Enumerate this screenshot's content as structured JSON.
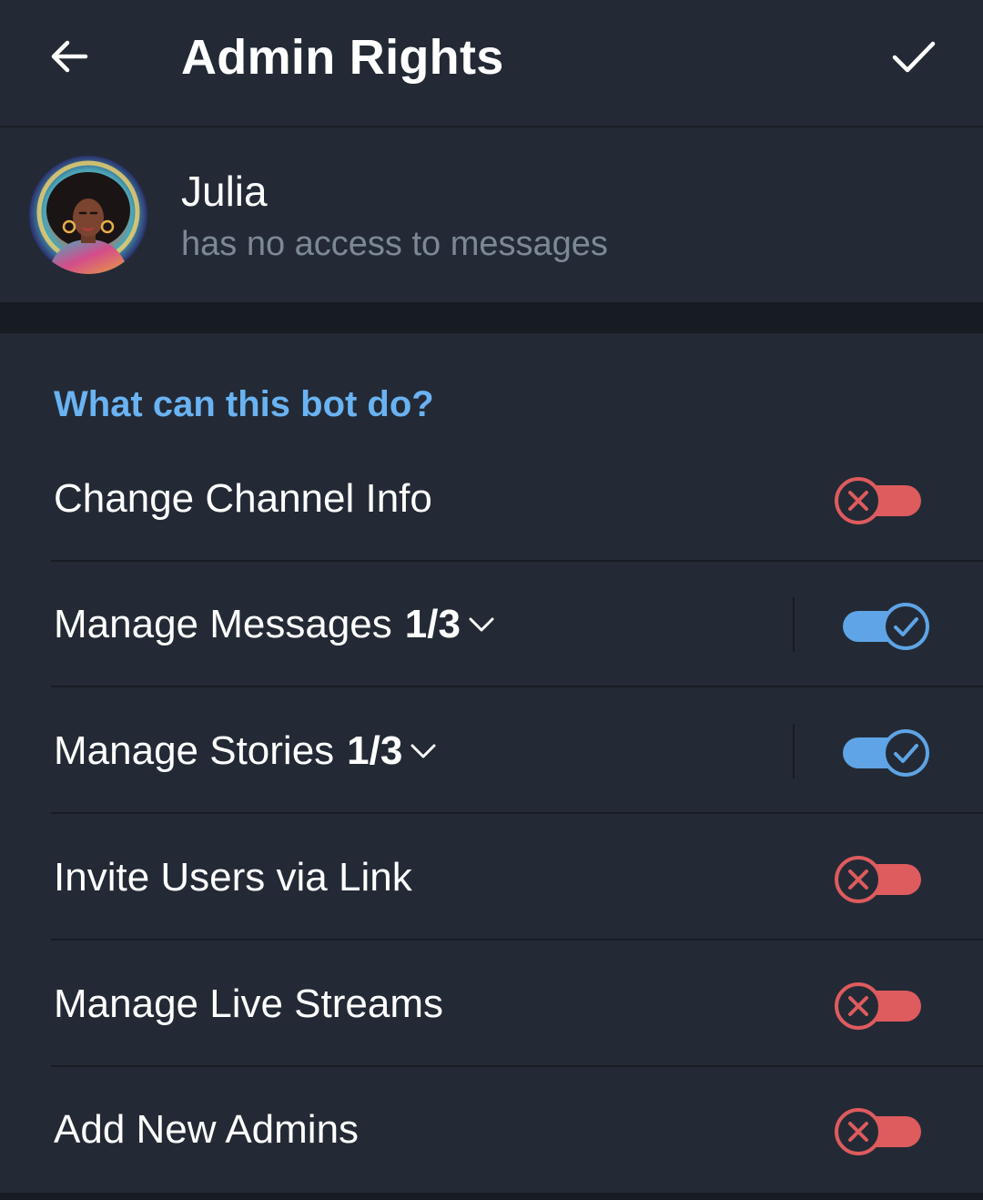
{
  "header": {
    "title": "Admin Rights",
    "back_icon": "arrow-left-icon",
    "done_icon": "checkmark-icon"
  },
  "user": {
    "name": "Julia",
    "status": "has no access to messages"
  },
  "rights": {
    "section_title": "What can this bot do?",
    "items": [
      {
        "label": "Change Channel Info",
        "count": "",
        "enabled": false
      },
      {
        "label": "Manage Messages",
        "count": "1/3",
        "enabled": true
      },
      {
        "label": "Manage Stories",
        "count": "1/3",
        "enabled": true
      },
      {
        "label": "Invite Users via Link",
        "count": "",
        "enabled": false
      },
      {
        "label": "Manage Live Streams",
        "count": "",
        "enabled": false
      },
      {
        "label": "Add New Admins",
        "count": "",
        "enabled": false
      }
    ]
  },
  "colors": {
    "background": "#232a35",
    "accent": "#6ab3f3",
    "toggle_on": "#5ea4e6",
    "toggle_off": "#de5b5e",
    "subtitle": "#7d8896"
  }
}
